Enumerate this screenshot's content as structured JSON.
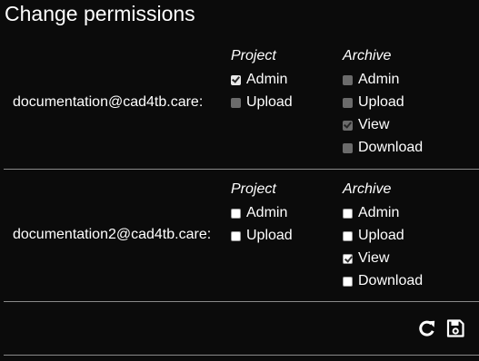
{
  "title": "Change permissions",
  "group_labels": {
    "project": "Project",
    "archive": "Archive"
  },
  "users": [
    {
      "email": "documentation@cad4tb.care:",
      "project": [
        {
          "label": "Admin",
          "checked": true,
          "enabled": false,
          "light": true
        },
        {
          "label": "Upload",
          "checked": false,
          "enabled": false,
          "light": false
        }
      ],
      "archive": [
        {
          "label": "Admin",
          "checked": false,
          "enabled": false
        },
        {
          "label": "Upload",
          "checked": false,
          "enabled": false
        },
        {
          "label": "View",
          "checked": true,
          "enabled": false
        },
        {
          "label": "Download",
          "checked": false,
          "enabled": false
        }
      ]
    },
    {
      "email": "documentation2@cad4tb.care:",
      "project": [
        {
          "label": "Admin",
          "checked": false,
          "enabled": true
        },
        {
          "label": "Upload",
          "checked": false,
          "enabled": true
        }
      ],
      "archive": [
        {
          "label": "Admin",
          "checked": false,
          "enabled": true
        },
        {
          "label": "Upload",
          "checked": false,
          "enabled": true
        },
        {
          "label": "View",
          "checked": true,
          "enabled": true
        },
        {
          "label": "Download",
          "checked": false,
          "enabled": true
        }
      ]
    }
  ],
  "footer": {
    "refresh_icon": "refresh-icon",
    "save_icon": "save-icon"
  }
}
